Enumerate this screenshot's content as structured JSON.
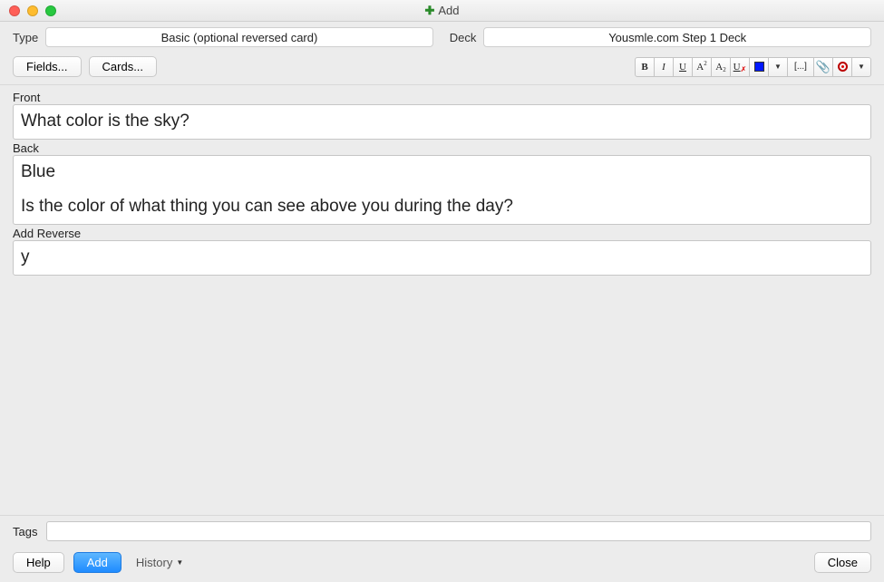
{
  "window": {
    "title": "Add"
  },
  "selectors": {
    "type_label": "Type",
    "type_value": "Basic (optional reversed card)",
    "deck_label": "Deck",
    "deck_value": "Yousmle.com Step 1 Deck"
  },
  "buttons": {
    "fields": "Fields...",
    "cards": "Cards...",
    "help": "Help",
    "add": "Add",
    "history": "History",
    "close": "Close"
  },
  "fmt": {
    "bold": "B",
    "italic": "I",
    "underline": "U",
    "super": "A",
    "sub": "A",
    "clear": "U",
    "cloze": "[...]"
  },
  "fields": {
    "front_label": "Front",
    "front_value": "What color is the sky?",
    "back_label": "Back",
    "back_line1": "Blue",
    "back_line2": "Is the color of what thing you can see above you during the day?",
    "reverse_label": "Add Reverse",
    "reverse_value": "y",
    "tags_label": "Tags",
    "tags_value": ""
  },
  "colors": {
    "traffic_red": "#ff5f57",
    "traffic_yellow": "#febc2e",
    "traffic_green": "#28c840"
  }
}
